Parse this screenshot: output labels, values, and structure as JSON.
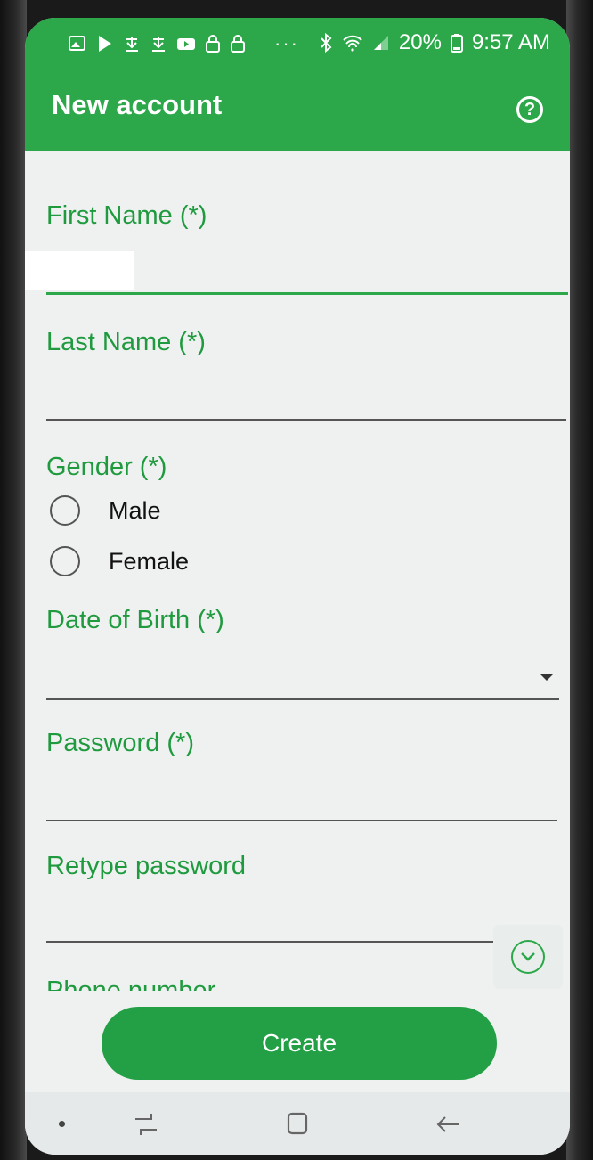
{
  "status_bar": {
    "battery": "20%",
    "time": "9:57 AM"
  },
  "app_bar": {
    "title": "New account",
    "help_icon": "question-circle"
  },
  "form": {
    "first_name": {
      "label": "First Name (*)",
      "value": ""
    },
    "last_name": {
      "label": "Last Name (*)",
      "value": ""
    },
    "gender": {
      "label": "Gender (*)",
      "options": [
        "Male",
        "Female"
      ]
    },
    "date_of_birth": {
      "label": "Date of Birth (*)",
      "value": ""
    },
    "password": {
      "label": "Password (*)",
      "value": ""
    },
    "retype_password": {
      "label": "Retype password",
      "value": ""
    },
    "phone_number": {
      "label": "Phone number"
    }
  },
  "actions": {
    "create_label": "Create"
  },
  "colors": {
    "accent": "#2ca84a",
    "label_green": "#1f9a3e",
    "background": "#eef1f0"
  }
}
